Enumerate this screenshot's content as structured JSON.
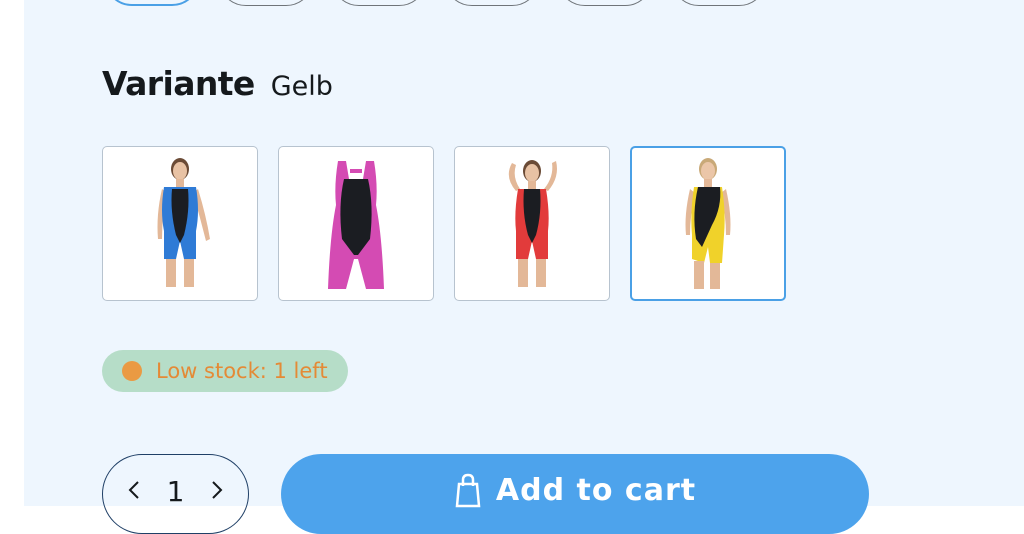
{
  "variant": {
    "label": "Variante",
    "selected_value": "Gelb",
    "options": [
      {
        "name": "blue",
        "photo_icon": "swimsuit-blue-icon",
        "accent": "#2f7bd6",
        "trim": "#1b1d22"
      },
      {
        "name": "pink",
        "photo_icon": "swimsuit-pink-icon",
        "accent": "#d44bb3",
        "trim": "#1b1d22"
      },
      {
        "name": "red",
        "photo_icon": "swimsuit-red-icon",
        "accent": "#e23b3b",
        "trim": "#1b1d22"
      },
      {
        "name": "yellow",
        "photo_icon": "swimsuit-yellow-icon",
        "accent": "#f0d22a",
        "trim": "#1b1d22",
        "selected": true
      }
    ]
  },
  "stock": {
    "text": "Low stock: 1 left",
    "dot_color": "#ea9a43",
    "badge_color": "#b6ddc8"
  },
  "quantity": {
    "value": "1",
    "decrement_icon": "chevron-left-icon",
    "increment_icon": "chevron-right-icon"
  },
  "cart": {
    "label": "Add to cart",
    "icon": "shopping-bag-icon",
    "color": "#4da3ec"
  },
  "colors": {
    "panel_bg": "#eef6fe",
    "selected_border": "#4aa0e6"
  }
}
